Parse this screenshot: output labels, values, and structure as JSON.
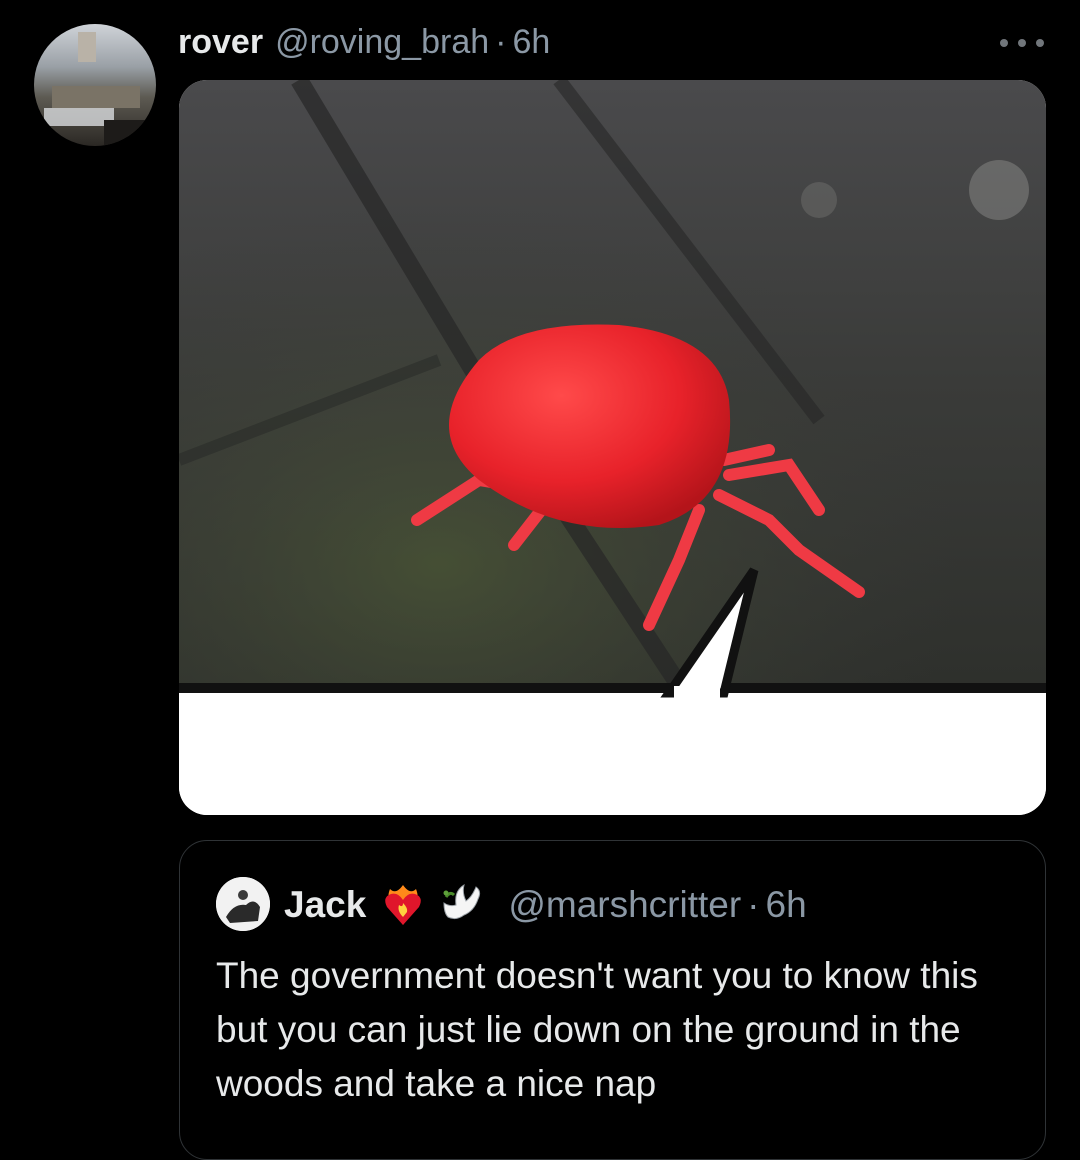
{
  "tweet": {
    "display_name": "rover",
    "handle": "@roving_brah",
    "separator": "·",
    "time": "6h",
    "more_icon": "more-horizontal-icon",
    "media": {
      "subject": "red velvet mite on mossy stone with speech bubble",
      "colors": {
        "mite": "#e8222a",
        "ground": "#3b3b3b",
        "bubble": "#ffffff"
      }
    }
  },
  "quoted_tweet": {
    "display_name": "Jack",
    "emoji_1": "heart-on-fire-icon",
    "emoji_2": "dove-icon",
    "handle": "@marshcritter",
    "separator": "·",
    "time": "6h",
    "text": "The government doesn't want you to know this but you can just lie down on the ground in the woods and take a nice nap"
  },
  "colors": {
    "background": "#000000",
    "text_primary": "#e7e9ea",
    "text_secondary": "#8b98a5",
    "border": "#2f3336"
  }
}
